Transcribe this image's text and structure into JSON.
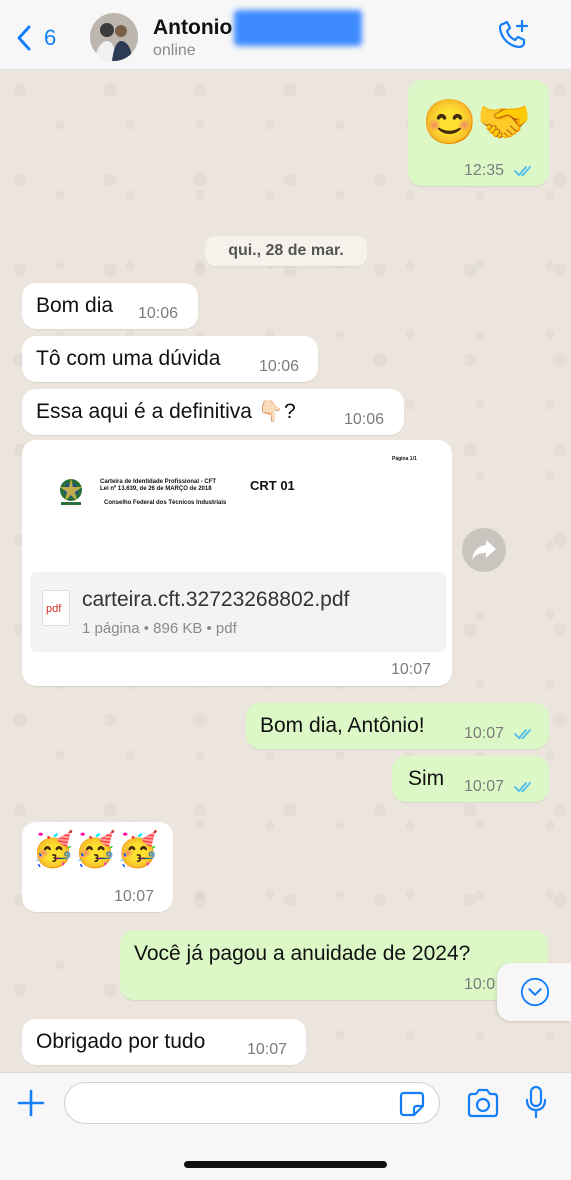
{
  "header": {
    "back_count": "6",
    "contact_name": "Antonio",
    "status": "online"
  },
  "date_separator": "qui., 28 de mar.",
  "messages": [
    {
      "dir": "out",
      "emoji": "😊🤝",
      "time": "12:35"
    },
    {
      "dir": "in",
      "text": "Bom dia",
      "time": "10:06"
    },
    {
      "dir": "in",
      "text": "Tô com uma dúvida",
      "time": "10:06"
    },
    {
      "dir": "in",
      "text": "Essa aqui é a definitiva 👇🏻?",
      "time": "10:06"
    },
    {
      "dir": "in",
      "document": {
        "preview_title": "Carteira de Identidade Profissional - CFT",
        "preview_law": "Lei nº 13.639, de 26 de MARÇO de 2018",
        "preview_org": "Conselho Federal dos Técnicos Industriais",
        "preview_code": "CRT 01",
        "preview_page": "Página 1/1",
        "file_name": "carteira.cft.32723268802.pdf",
        "meta": "1 página • 896 KB • pdf",
        "icon_label": "pdf"
      },
      "time": "10:07"
    },
    {
      "dir": "out",
      "text": "Bom dia, Antônio!",
      "time": "10:07"
    },
    {
      "dir": "out",
      "text": "Sim",
      "time": "10:07"
    },
    {
      "dir": "in",
      "emoji": "🥳🥳🥳",
      "time": "10:07"
    },
    {
      "dir": "out",
      "text": "Você já pagou a anuidade de 2024?",
      "time": "10:0"
    },
    {
      "dir": "in",
      "text": "Obrigado por tudo",
      "time": "10:07"
    }
  ],
  "composer": {
    "placeholder": ""
  },
  "colors": {
    "accent": "#147efb",
    "outgoing_bubble": "#dbf8c6",
    "incoming_bubble": "#ffffff",
    "read_ticks": "#53bdeb"
  }
}
